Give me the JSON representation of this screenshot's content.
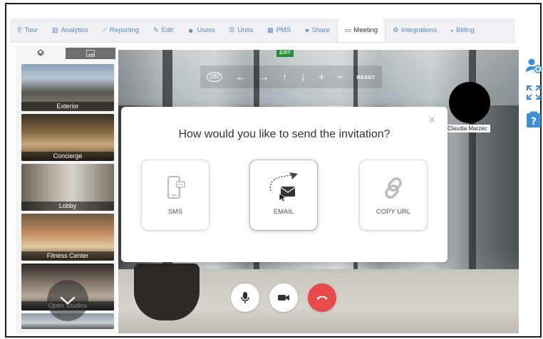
{
  "tabs": [
    {
      "label": "Tour",
      "icon": "pin-icon",
      "glyph": "⚲"
    },
    {
      "label": "Analytics",
      "icon": "bar-chart-icon",
      "glyph": "▥"
    },
    {
      "label": "Reporting",
      "icon": "line-chart-icon",
      "glyph": "⟋"
    },
    {
      "label": "Edit",
      "icon": "pencil-icon",
      "glyph": "✎"
    },
    {
      "label": "Users",
      "icon": "users-icon",
      "glyph": "☻"
    },
    {
      "label": "Units",
      "icon": "list-icon",
      "glyph": "☰"
    },
    {
      "label": "PMS",
      "icon": "building-icon",
      "glyph": "▦"
    },
    {
      "label": "Share",
      "icon": "heart-icon",
      "glyph": "♥"
    },
    {
      "label": "Meeting",
      "icon": "monitor-icon",
      "glyph": "▭",
      "active": true
    },
    {
      "label": "Integrations",
      "icon": "gear-icon",
      "glyph": "⚙"
    },
    {
      "label": "Billing",
      "icon": "lock-icon",
      "glyph": "🔒"
    }
  ],
  "sidebar": {
    "scenes": [
      {
        "label": "Exterior"
      },
      {
        "label": "Concierge"
      },
      {
        "label": "Lobby"
      },
      {
        "label": "Fitness Center"
      },
      {
        "label": "Open Studios"
      }
    ]
  },
  "viewer": {
    "exit_sign": "EXIT",
    "rotate_label": "180",
    "reset_label": "RESET",
    "participant_name": "Claudia Marzec"
  },
  "modal": {
    "title": "How would you like to send the invitation?",
    "options": [
      {
        "label": "SMS"
      },
      {
        "label": "EMAIL"
      },
      {
        "label": "COPY URL"
      }
    ]
  },
  "colors": {
    "accent_blue": "#5b86c4",
    "tool_blue": "#3d8fd6",
    "hangup_red": "#e84a4a"
  }
}
